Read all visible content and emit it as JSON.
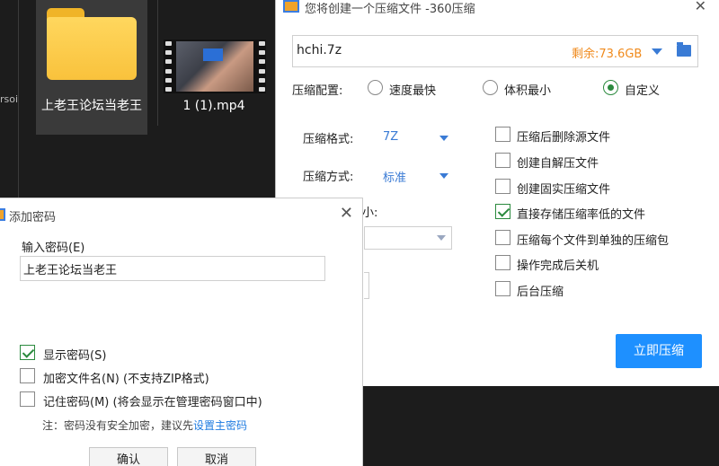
{
  "explorer": {
    "edge_text": "rsoi",
    "files": [
      {
        "name": "上老王论坛当老王",
        "icon": "folder-icon"
      },
      {
        "name": "1 (1).mp4",
        "icon": "video-thumbnail-icon"
      }
    ]
  },
  "compress_dialog": {
    "title": "您将创建一个压缩文件 -360压缩",
    "path": "hchi.7z",
    "free_space": "剩余:73.6GB",
    "config_label": "压缩配置:",
    "radio_options": [
      {
        "label": "速度最快",
        "selected": false
      },
      {
        "label": "体积最小",
        "selected": false
      },
      {
        "label": "自定义",
        "selected": true
      }
    ],
    "format_label": "压缩格式:",
    "format_value": "7Z",
    "method_label": "压缩方式:",
    "method_value": "标准",
    "partial_label": "小:",
    "options": [
      {
        "label": "压缩后删除源文件",
        "checked": false
      },
      {
        "label": "创建自解压文件",
        "checked": false
      },
      {
        "label": "创建固实压缩文件",
        "checked": false
      },
      {
        "label": "直接存储压缩率低的文件",
        "checked": true
      },
      {
        "label": "压缩每个文件到单独的压缩包",
        "checked": false
      },
      {
        "label": "操作完成后关机",
        "checked": false
      },
      {
        "label": "后台压缩",
        "checked": false
      }
    ],
    "submit_label": "立即压缩"
  },
  "password_dialog": {
    "title": "添加密码",
    "input_label": "输入密码(E)",
    "password_value": "上老王论坛当老王",
    "options": [
      {
        "label": "显示密码(S)",
        "checked": true
      },
      {
        "label": "加密文件名(N) (不支持ZIP格式)",
        "checked": false
      },
      {
        "label": "记住密码(M) (将会显示在管理密码窗口中)",
        "checked": false
      }
    ],
    "note": "注：密码没有安全加密，建议先",
    "note_link": "设置主密码",
    "ok_label": "确认",
    "cancel_label": "取消"
  },
  "colors": {
    "accent": "#1e90ff",
    "check_green": "#2b8a3e",
    "free_space_orange": "#f08a1c",
    "explorer_bg": "#1c1c1c"
  }
}
